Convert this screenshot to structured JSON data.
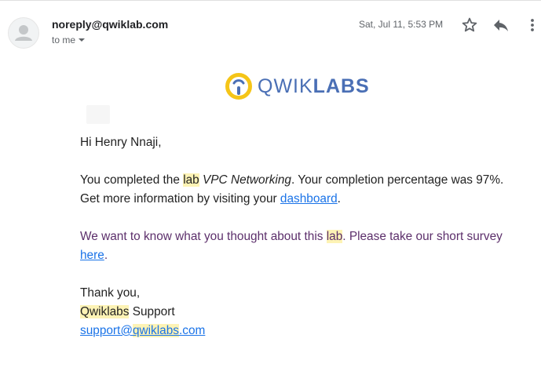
{
  "header": {
    "sender": "noreply@qwiklab.com",
    "recipient_line": "to me",
    "date": "Sat, Jul 11, 5:53 PM"
  },
  "icons": {
    "avatar": "person-avatar-icon",
    "star": "star-icon",
    "reply": "reply-icon",
    "more": "more-vertical-icon",
    "caret": "chevron-down-icon"
  },
  "logo": {
    "text_light": "QWIK",
    "text_bold": "LABS",
    "color": "#4a6fb5",
    "accent": "#f5c518"
  },
  "body": {
    "greeting": "Hi Henry Nnaji,",
    "p1_before": "You completed the ",
    "p1_lab": "lab",
    "p1_space": " ",
    "p1_labname": "VPC Networking",
    "p1_after": ". Your completion percentage was 97%. Get more information by visiting your ",
    "p1_link": "dashboard",
    "p1_end": ".",
    "p2_before": "We want to know what you thought about this ",
    "p2_lab": "lab",
    "p2_after": ". Please take our short survey ",
    "p2_link": "here",
    "p2_end": ".",
    "thanks": "Thank you,",
    "sig_name_hl": "Qwiklabs",
    "sig_name_rest": " Support",
    "email_pre": "support@",
    "email_hl": "qwiklabs",
    "email_post": ".com"
  },
  "colors": {
    "link": "#1a73e8",
    "highlight": "#fdf3b5",
    "purple_text": "#5c2f6b"
  }
}
